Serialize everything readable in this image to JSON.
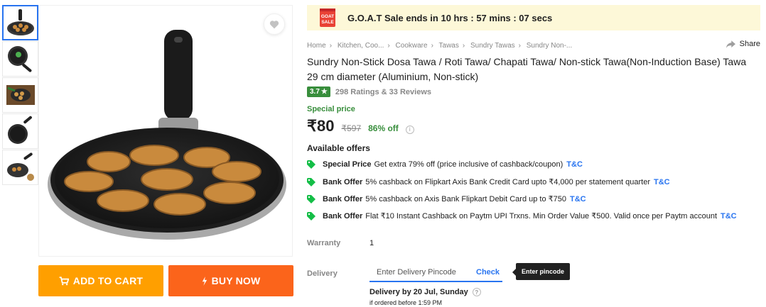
{
  "sale_banner": {
    "logo_line1": "GOAT",
    "logo_line2": "SALE",
    "text": "G.O.A.T Sale ends in 10 hrs : 57 mins : 07 secs"
  },
  "breadcrumbs": [
    "Home",
    "Kitchen, Coo...",
    "Cookware",
    "Tawas",
    "Sundry Tawas",
    "Sundry Non-..."
  ],
  "share_label": "Share",
  "product": {
    "title": "Sundry Non-Stick Dosa Tawa / Roti Tawa/ Chapati Tawa/ Non-stick Tawa(Non-Induction Base) Tawa 29 cm diameter  (Aluminium, Non-stick)",
    "rating": "3.7",
    "rating_star": "★",
    "ratings_reviews": "298 Ratings & 33 Reviews",
    "special_price_label": "Special price",
    "price": "₹80",
    "mrp": "₹597",
    "discount": "86% off",
    "info_icon": "i"
  },
  "offers": {
    "heading": "Available offers",
    "items": [
      {
        "type": "Special Price",
        "text": "Get extra 79% off (price inclusive of cashback/coupon)",
        "tc": "T&C"
      },
      {
        "type": "Bank Offer",
        "text": "5% cashback on Flipkart Axis Bank Credit Card upto ₹4,000 per statement quarter",
        "tc": "T&C"
      },
      {
        "type": "Bank Offer",
        "text": "5% cashback on Axis Bank Flipkart Debit Card up to ₹750",
        "tc": "T&C"
      },
      {
        "type": "Bank Offer",
        "text": "Flat ₹10 Instant Cashback on Paytm UPI Trxns. Min Order Value ₹500. Valid once per Paytm account",
        "tc": "T&C"
      }
    ]
  },
  "warranty": {
    "label": "Warranty",
    "value": "1"
  },
  "delivery": {
    "label": "Delivery",
    "pincode_placeholder": "Enter Delivery Pincode",
    "check_label": "Check",
    "tooltip": "Enter pincode",
    "date": "Delivery by 20 Jul, Sunday",
    "help_icon": "?",
    "cutoff": "if ordered before 1:59 PM"
  },
  "buttons": {
    "add_to_cart": "ADD TO CART",
    "buy_now": "BUY NOW"
  },
  "colors": {
    "accent": "#2874f0",
    "cart": "#ff9f00",
    "buy": "#fb641b",
    "green": "#388e3c",
    "sale_bg": "#fdf8d8"
  },
  "icons": [
    "heart-icon",
    "cart-icon",
    "lightning-icon",
    "share-icon",
    "offer-tag-icon",
    "info-icon",
    "help-icon",
    "goat-sale-logo"
  ]
}
